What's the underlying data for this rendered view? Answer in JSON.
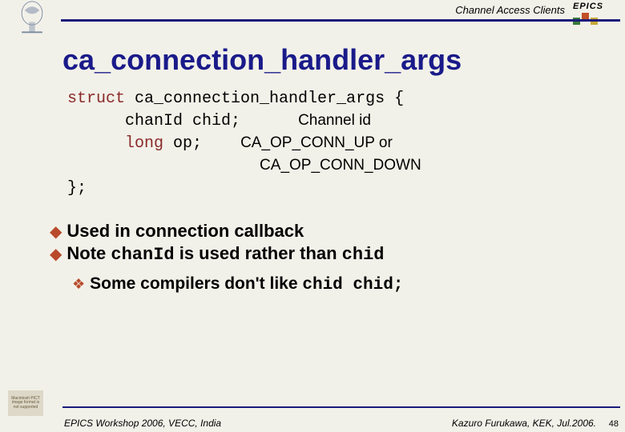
{
  "header": {
    "section": "Channel Access Clients",
    "logo_text": "EPICS"
  },
  "title": "ca_connection_handler_args",
  "code": {
    "line1_kw": "struct",
    "line1_rest": " ca_connection_handler_args {",
    "line2_pre": "      chanId chid;",
    "line2_ann": "Channel id",
    "line3_kw": "long",
    "line3_rest": " op;",
    "line3_ann": "CA_OP_CONN_UP or",
    "line4_ann": "CA_OP_CONN_DOWN",
    "line5": "};"
  },
  "bullets": {
    "b1": "Used in connection callback",
    "b2_pre": "Note ",
    "b2_mono1": "chanId",
    "b2_mid": " is used rather than ",
    "b2_mono2": "chid",
    "sub_pre": "Some compilers don't like ",
    "sub_mono": "chid chid;"
  },
  "footer": {
    "placeholder": "Macintosh PICT image format is not supported",
    "left": "EPICS Workshop 2006, VECC, India",
    "right": "Kazuro Furukawa, KEK, Jul.2006.",
    "page": "48"
  }
}
